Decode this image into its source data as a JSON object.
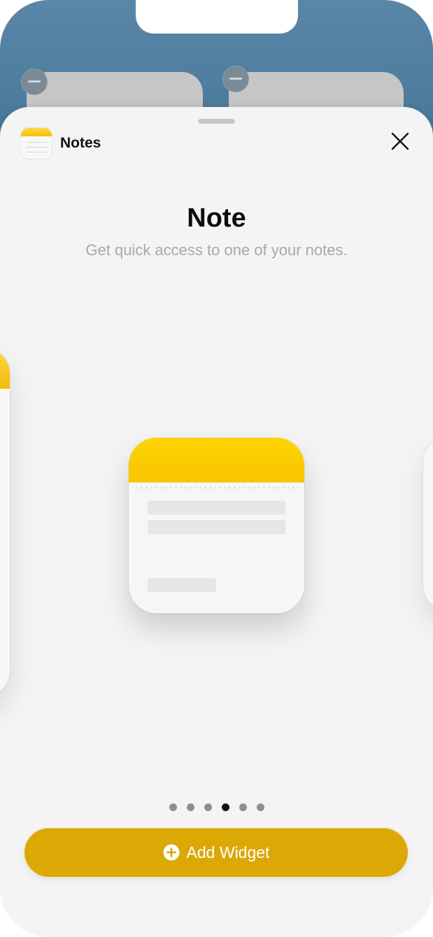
{
  "app": {
    "name": "Notes",
    "icon": "notes-app-icon"
  },
  "widget": {
    "title": "Note",
    "description": "Get quick access to one of your notes."
  },
  "pagination": {
    "count": 6,
    "active_index": 3
  },
  "actions": {
    "add_widget_label": "Add Widget",
    "add_widget_icon": "plus-circle-icon",
    "close_icon": "close-icon"
  },
  "colors": {
    "accent": "#dba806",
    "note_yellow": "#ffd500",
    "wallpaper": "#4d7c9d"
  }
}
